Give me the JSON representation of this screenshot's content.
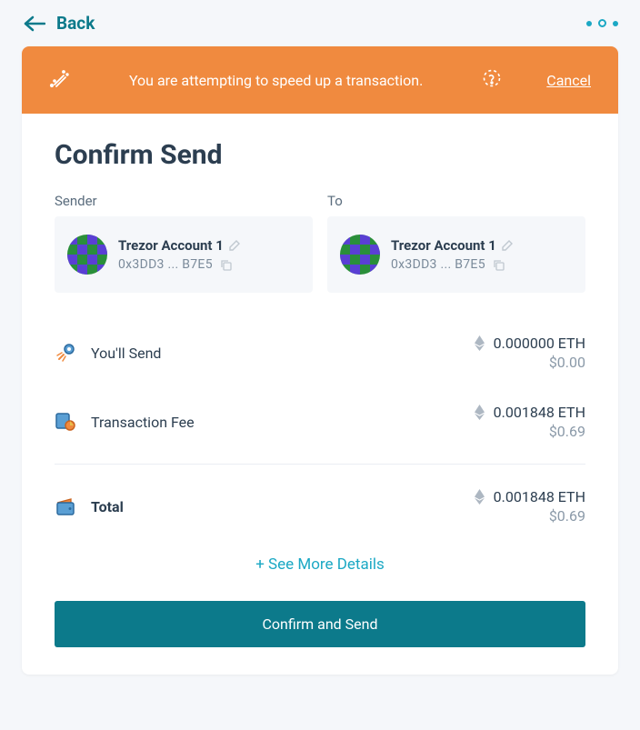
{
  "back_label": "Back",
  "banner": {
    "message": "You are attempting to speed up a transaction.",
    "cancel_label": "Cancel"
  },
  "title": "Confirm Send",
  "sender": {
    "label": "Sender",
    "name": "Trezor Account 1",
    "address": "0x3DD3 ... B7E5"
  },
  "recipient": {
    "label": "To",
    "name": "Trezor Account 1",
    "address": "0x3DD3 ... B7E5"
  },
  "lines": {
    "send": {
      "label": "You'll Send",
      "amount_eth": "0.000000 ETH",
      "amount_usd": "$0.00"
    },
    "fee": {
      "label": "Transaction Fee",
      "amount_eth": "0.001848 ETH",
      "amount_usd": "$0.69"
    },
    "total": {
      "label": "Total",
      "amount_eth": "0.001848 ETH",
      "amount_usd": "$0.69"
    }
  },
  "see_more_label": "+ See More Details",
  "confirm_button_label": "Confirm and Send"
}
